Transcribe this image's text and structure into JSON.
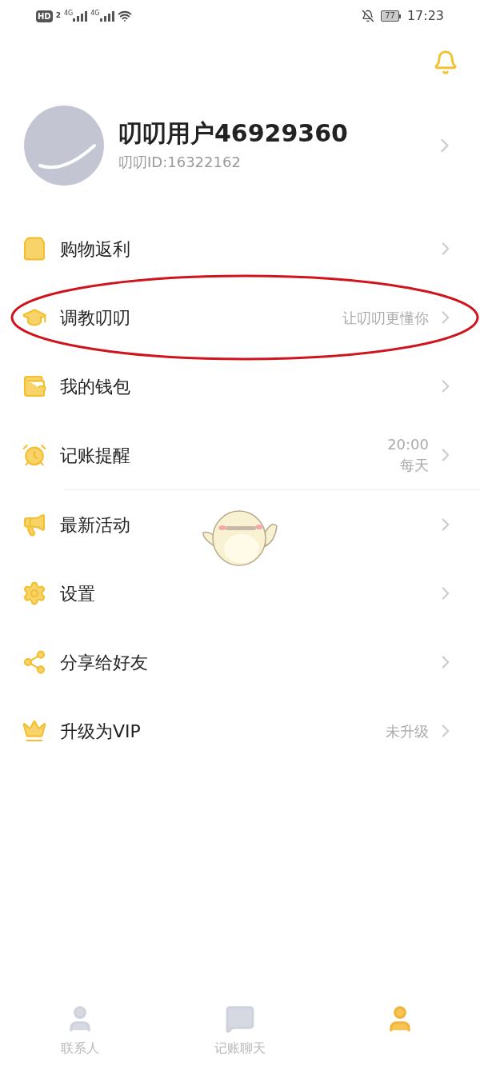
{
  "status_bar": {
    "hd_badge": "HD",
    "sim_number": "2",
    "signal_labels": [
      "4G",
      "4G"
    ],
    "battery": "77",
    "time": "17:23"
  },
  "profile": {
    "name": "叨叨用户46929360",
    "id": "叨叨ID:16322162"
  },
  "menu": [
    {
      "label": "购物返利"
    },
    {
      "label": "调教叨叨",
      "value": "让叨叨更懂你",
      "circled": true
    },
    {
      "label": "我的钱包"
    },
    {
      "label": "记账提醒",
      "value_lines": [
        "20:00",
        "每天"
      ]
    },
    {
      "label": "最新活动"
    },
    {
      "label": "设置"
    },
    {
      "label": "分享给好友"
    },
    {
      "label": "升级为VIP",
      "value": "未升级"
    }
  ],
  "tabs": [
    {
      "label": "联系人",
      "selected": false
    },
    {
      "label": "记账聊天",
      "selected": false
    },
    {
      "selected": true
    }
  ]
}
